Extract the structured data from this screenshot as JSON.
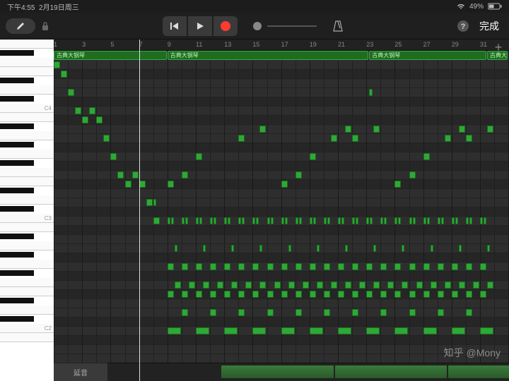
{
  "status": {
    "time": "下午4:55",
    "date": "2月19日周三",
    "battery": "49%"
  },
  "toolbar": {
    "done": "完成"
  },
  "ruler": {
    "bars": [
      1,
      3,
      5,
      7,
      9,
      11,
      13,
      15,
      17,
      19,
      21,
      23,
      25,
      27,
      29,
      31
    ]
  },
  "playhead_bar": 7,
  "regions": [
    {
      "label": "古典大钢琴",
      "start": 1,
      "end": 9
    },
    {
      "label": "古典大钢琴",
      "start": 9,
      "end": 23.2
    },
    {
      "label": "古典大钢琴",
      "start": 23.2,
      "end": 31.5
    },
    {
      "label": "古典大钢",
      "start": 31.5,
      "end": 33
    }
  ],
  "piano": {
    "top_midi": 79,
    "rows": 33,
    "labels": {
      "72": "C4",
      "60": "C3",
      "48": "C2"
    }
  },
  "velocity": {
    "label": "延音",
    "lanes": [
      {
        "start": 9,
        "end": 17
      },
      {
        "start": 17,
        "end": 25
      },
      {
        "start": 25,
        "end": 32
      }
    ]
  },
  "notes": [
    {
      "p": 79,
      "s": 1.0,
      "d": 0.5
    },
    {
      "p": 78,
      "s": 1.5,
      "d": 0.5
    },
    {
      "p": 76,
      "s": 2.0,
      "d": 0.5
    },
    {
      "p": 74,
      "s": 2.5,
      "d": 0.5
    },
    {
      "p": 73,
      "s": 3.0,
      "d": 0.5
    },
    {
      "p": 74,
      "s": 3.5,
      "d": 0.5
    },
    {
      "p": 73,
      "s": 4.0,
      "d": 0.5
    },
    {
      "p": 71,
      "s": 4.5,
      "d": 0.5
    },
    {
      "p": 69,
      "s": 5.0,
      "d": 0.5
    },
    {
      "p": 67,
      "s": 5.5,
      "d": 0.5
    },
    {
      "p": 66,
      "s": 6.0,
      "d": 0.5
    },
    {
      "p": 67,
      "s": 6.5,
      "d": 0.5
    },
    {
      "p": 66,
      "s": 7.0,
      "d": 0.5
    },
    {
      "p": 64,
      "s": 7.5,
      "d": 0.5
    },
    {
      "p": 62,
      "s": 8.0,
      "d": 0.5
    },
    {
      "p": 64,
      "s": 8.0,
      "d": 0.25
    },
    {
      "p": 76,
      "s": 23.2,
      "d": 0.3
    },
    {
      "p": 66,
      "s": 9.0,
      "d": 0.5
    },
    {
      "p": 66,
      "s": 17.0,
      "d": 0.5
    },
    {
      "p": 66,
      "s": 25.0,
      "d": 0.5
    },
    {
      "p": 67,
      "s": 10.0,
      "d": 0.5
    },
    {
      "p": 67,
      "s": 18.0,
      "d": 0.5
    },
    {
      "p": 67,
      "s": 26.0,
      "d": 0.5
    },
    {
      "p": 69,
      "s": 11.0,
      "d": 0.5
    },
    {
      "p": 69,
      "s": 19.0,
      "d": 0.5
    },
    {
      "p": 69,
      "s": 27.0,
      "d": 0.5
    },
    {
      "p": 71,
      "s": 14.0,
      "d": 0.5
    },
    {
      "p": 71,
      "s": 20.5,
      "d": 0.5
    },
    {
      "p": 71,
      "s": 22.0,
      "d": 0.5
    },
    {
      "p": 71,
      "s": 28.5,
      "d": 0.5
    },
    {
      "p": 71,
      "s": 30.0,
      "d": 0.5
    },
    {
      "p": 72,
      "s": 15.5,
      "d": 0.5
    },
    {
      "p": 72,
      "s": 21.5,
      "d": 0.5
    },
    {
      "p": 72,
      "s": 23.5,
      "d": 0.5
    },
    {
      "p": 72,
      "s": 29.5,
      "d": 0.5
    },
    {
      "p": 72,
      "s": 31.5,
      "d": 0.5
    },
    {
      "p": 62,
      "s": 9.0,
      "d": 0.25
    },
    {
      "p": 62,
      "s": 9.25,
      "d": 0.25
    },
    {
      "p": 62,
      "s": 10.0,
      "d": 0.25
    },
    {
      "p": 62,
      "s": 10.25,
      "d": 0.25
    },
    {
      "p": 62,
      "s": 11.0,
      "d": 0.25
    },
    {
      "p": 62,
      "s": 11.25,
      "d": 0.25
    },
    {
      "p": 62,
      "s": 12.0,
      "d": 0.25
    },
    {
      "p": 62,
      "s": 12.25,
      "d": 0.25
    },
    {
      "p": 62,
      "s": 13.0,
      "d": 0.25
    },
    {
      "p": 62,
      "s": 13.25,
      "d": 0.25
    },
    {
      "p": 62,
      "s": 14.0,
      "d": 0.25
    },
    {
      "p": 62,
      "s": 14.25,
      "d": 0.25
    },
    {
      "p": 62,
      "s": 15.0,
      "d": 0.25
    },
    {
      "p": 62,
      "s": 15.25,
      "d": 0.25
    },
    {
      "p": 62,
      "s": 16.0,
      "d": 0.25
    },
    {
      "p": 62,
      "s": 16.25,
      "d": 0.25
    },
    {
      "p": 62,
      "s": 17.0,
      "d": 0.25
    },
    {
      "p": 62,
      "s": 17.25,
      "d": 0.25
    },
    {
      "p": 62,
      "s": 18.0,
      "d": 0.25
    },
    {
      "p": 62,
      "s": 18.25,
      "d": 0.25
    },
    {
      "p": 62,
      "s": 19.0,
      "d": 0.25
    },
    {
      "p": 62,
      "s": 19.25,
      "d": 0.25
    },
    {
      "p": 62,
      "s": 20.0,
      "d": 0.25
    },
    {
      "p": 62,
      "s": 20.25,
      "d": 0.25
    },
    {
      "p": 62,
      "s": 21.0,
      "d": 0.25
    },
    {
      "p": 62,
      "s": 21.25,
      "d": 0.25
    },
    {
      "p": 62,
      "s": 22.0,
      "d": 0.25
    },
    {
      "p": 62,
      "s": 22.25,
      "d": 0.25
    },
    {
      "p": 62,
      "s": 23.0,
      "d": 0.25
    },
    {
      "p": 62,
      "s": 23.25,
      "d": 0.25
    },
    {
      "p": 62,
      "s": 24.0,
      "d": 0.25
    },
    {
      "p": 62,
      "s": 24.25,
      "d": 0.25
    },
    {
      "p": 62,
      "s": 25.0,
      "d": 0.25
    },
    {
      "p": 62,
      "s": 25.25,
      "d": 0.25
    },
    {
      "p": 62,
      "s": 26.0,
      "d": 0.25
    },
    {
      "p": 62,
      "s": 26.25,
      "d": 0.25
    },
    {
      "p": 62,
      "s": 27.0,
      "d": 0.25
    },
    {
      "p": 62,
      "s": 27.25,
      "d": 0.25
    },
    {
      "p": 62,
      "s": 28.0,
      "d": 0.25
    },
    {
      "p": 62,
      "s": 28.25,
      "d": 0.25
    },
    {
      "p": 62,
      "s": 29.0,
      "d": 0.25
    },
    {
      "p": 62,
      "s": 29.25,
      "d": 0.25
    },
    {
      "p": 62,
      "s": 30.0,
      "d": 0.25
    },
    {
      "p": 62,
      "s": 30.25,
      "d": 0.25
    },
    {
      "p": 62,
      "s": 31.0,
      "d": 0.25
    },
    {
      "p": 62,
      "s": 31.25,
      "d": 0.25
    },
    {
      "p": 57,
      "s": 9.0,
      "d": 0.5
    },
    {
      "p": 57,
      "s": 10.0,
      "d": 0.5
    },
    {
      "p": 57,
      "s": 11.0,
      "d": 0.5
    },
    {
      "p": 57,
      "s": 12.0,
      "d": 0.5
    },
    {
      "p": 57,
      "s": 13.0,
      "d": 0.5
    },
    {
      "p": 57,
      "s": 14.0,
      "d": 0.5
    },
    {
      "p": 57,
      "s": 15.0,
      "d": 0.5
    },
    {
      "p": 57,
      "s": 16.0,
      "d": 0.5
    },
    {
      "p": 57,
      "s": 17.0,
      "d": 0.5
    },
    {
      "p": 57,
      "s": 18.0,
      "d": 0.5
    },
    {
      "p": 57,
      "s": 19.0,
      "d": 0.5
    },
    {
      "p": 57,
      "s": 20.0,
      "d": 0.5
    },
    {
      "p": 57,
      "s": 21.0,
      "d": 0.5
    },
    {
      "p": 57,
      "s": 22.0,
      "d": 0.5
    },
    {
      "p": 57,
      "s": 23.0,
      "d": 0.5
    },
    {
      "p": 57,
      "s": 24.0,
      "d": 0.5
    },
    {
      "p": 57,
      "s": 25.0,
      "d": 0.5
    },
    {
      "p": 57,
      "s": 26.0,
      "d": 0.5
    },
    {
      "p": 57,
      "s": 27.0,
      "d": 0.5
    },
    {
      "p": 57,
      "s": 28.0,
      "d": 0.5
    },
    {
      "p": 57,
      "s": 29.0,
      "d": 0.5
    },
    {
      "p": 57,
      "s": 30.0,
      "d": 0.5
    },
    {
      "p": 57,
      "s": 31.0,
      "d": 0.5
    },
    {
      "p": 54,
      "s": 9.0,
      "d": 0.5
    },
    {
      "p": 54,
      "s": 10.0,
      "d": 0.5
    },
    {
      "p": 54,
      "s": 11.0,
      "d": 0.5
    },
    {
      "p": 54,
      "s": 12.0,
      "d": 0.5
    },
    {
      "p": 54,
      "s": 13.0,
      "d": 0.5
    },
    {
      "p": 54,
      "s": 14.0,
      "d": 0.5
    },
    {
      "p": 54,
      "s": 15.0,
      "d": 0.5
    },
    {
      "p": 54,
      "s": 16.0,
      "d": 0.5
    },
    {
      "p": 54,
      "s": 17.0,
      "d": 0.5
    },
    {
      "p": 54,
      "s": 18.0,
      "d": 0.5
    },
    {
      "p": 54,
      "s": 19.0,
      "d": 0.5
    },
    {
      "p": 54,
      "s": 20.0,
      "d": 0.5
    },
    {
      "p": 54,
      "s": 21.0,
      "d": 0.5
    },
    {
      "p": 54,
      "s": 22.0,
      "d": 0.5
    },
    {
      "p": 54,
      "s": 23.0,
      "d": 0.5
    },
    {
      "p": 54,
      "s": 24.0,
      "d": 0.5
    },
    {
      "p": 54,
      "s": 25.0,
      "d": 0.5
    },
    {
      "p": 54,
      "s": 26.0,
      "d": 0.5
    },
    {
      "p": 54,
      "s": 27.0,
      "d": 0.5
    },
    {
      "p": 54,
      "s": 28.0,
      "d": 0.5
    },
    {
      "p": 54,
      "s": 29.0,
      "d": 0.5
    },
    {
      "p": 54,
      "s": 30.0,
      "d": 0.5
    },
    {
      "p": 54,
      "s": 31.0,
      "d": 0.5
    },
    {
      "p": 55,
      "s": 9.5,
      "d": 0.5
    },
    {
      "p": 55,
      "s": 10.5,
      "d": 0.5
    },
    {
      "p": 55,
      "s": 11.5,
      "d": 0.5
    },
    {
      "p": 55,
      "s": 12.5,
      "d": 0.5
    },
    {
      "p": 55,
      "s": 13.5,
      "d": 0.5
    },
    {
      "p": 55,
      "s": 14.5,
      "d": 0.5
    },
    {
      "p": 55,
      "s": 15.5,
      "d": 0.5
    },
    {
      "p": 55,
      "s": 16.5,
      "d": 0.5
    },
    {
      "p": 55,
      "s": 17.5,
      "d": 0.5
    },
    {
      "p": 55,
      "s": 18.5,
      "d": 0.5
    },
    {
      "p": 55,
      "s": 19.5,
      "d": 0.5
    },
    {
      "p": 55,
      "s": 20.5,
      "d": 0.5
    },
    {
      "p": 55,
      "s": 21.5,
      "d": 0.5
    },
    {
      "p": 55,
      "s": 22.5,
      "d": 0.5
    },
    {
      "p": 55,
      "s": 23.5,
      "d": 0.5
    },
    {
      "p": 55,
      "s": 24.5,
      "d": 0.5
    },
    {
      "p": 55,
      "s": 25.5,
      "d": 0.5
    },
    {
      "p": 55,
      "s": 26.5,
      "d": 0.5
    },
    {
      "p": 55,
      "s": 27.5,
      "d": 0.5
    },
    {
      "p": 55,
      "s": 28.5,
      "d": 0.5
    },
    {
      "p": 55,
      "s": 29.5,
      "d": 0.5
    },
    {
      "p": 55,
      "s": 30.5,
      "d": 0.5
    },
    {
      "p": 55,
      "s": 31.5,
      "d": 0.5
    },
    {
      "p": 59,
      "s": 9.5,
      "d": 0.25
    },
    {
      "p": 59,
      "s": 11.5,
      "d": 0.25
    },
    {
      "p": 59,
      "s": 13.5,
      "d": 0.25
    },
    {
      "p": 59,
      "s": 15.5,
      "d": 0.25
    },
    {
      "p": 59,
      "s": 17.5,
      "d": 0.25
    },
    {
      "p": 59,
      "s": 19.5,
      "d": 0.25
    },
    {
      "p": 59,
      "s": 21.5,
      "d": 0.25
    },
    {
      "p": 59,
      "s": 23.5,
      "d": 0.25
    },
    {
      "p": 59,
      "s": 25.5,
      "d": 0.25
    },
    {
      "p": 59,
      "s": 27.5,
      "d": 0.25
    },
    {
      "p": 59,
      "s": 29.5,
      "d": 0.25
    },
    {
      "p": 59,
      "s": 31.5,
      "d": 0.25
    },
    {
      "p": 50,
      "s": 9.0,
      "d": 1.0
    },
    {
      "p": 50,
      "s": 11.0,
      "d": 1.0
    },
    {
      "p": 50,
      "s": 13.0,
      "d": 1.0
    },
    {
      "p": 50,
      "s": 15.0,
      "d": 1.0
    },
    {
      "p": 50,
      "s": 17.0,
      "d": 1.0
    },
    {
      "p": 50,
      "s": 19.0,
      "d": 1.0
    },
    {
      "p": 50,
      "s": 21.0,
      "d": 1.0
    },
    {
      "p": 50,
      "s": 23.0,
      "d": 1.0
    },
    {
      "p": 50,
      "s": 25.0,
      "d": 1.0
    },
    {
      "p": 50,
      "s": 27.0,
      "d": 1.0
    },
    {
      "p": 50,
      "s": 29.0,
      "d": 1.0
    },
    {
      "p": 50,
      "s": 31.0,
      "d": 1.0
    },
    {
      "p": 52,
      "s": 10.0,
      "d": 0.5
    },
    {
      "p": 52,
      "s": 12.0,
      "d": 0.5
    },
    {
      "p": 52,
      "s": 14.0,
      "d": 0.5
    },
    {
      "p": 52,
      "s": 16.0,
      "d": 0.5
    },
    {
      "p": 52,
      "s": 18.0,
      "d": 0.5
    },
    {
      "p": 52,
      "s": 20.0,
      "d": 0.5
    },
    {
      "p": 52,
      "s": 22.0,
      "d": 0.5
    },
    {
      "p": 52,
      "s": 24.0,
      "d": 0.5
    },
    {
      "p": 52,
      "s": 26.0,
      "d": 0.5
    },
    {
      "p": 52,
      "s": 28.0,
      "d": 0.5
    },
    {
      "p": 52,
      "s": 30.0,
      "d": 0.5
    }
  ],
  "watermark": "知乎 @Mony"
}
